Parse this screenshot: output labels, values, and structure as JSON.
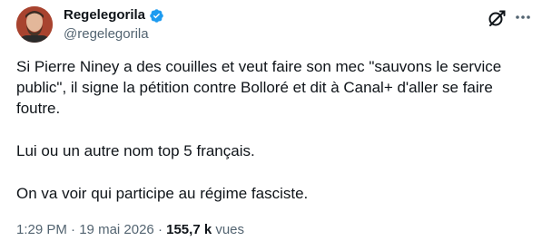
{
  "author": {
    "display_name": "Regelegorila",
    "handle": "@regelegorila",
    "verified": true
  },
  "tweet": {
    "paragraphs": [
      "Si Pierre Niney a des couilles et veut faire son mec \"sauvons le service public\", il signe la pétition contre Bolloré et dit à Canal+ d'aller se faire foutre.",
      "Lui ou un autre nom top 5 français.",
      "On va voir qui participe au régime fasciste."
    ]
  },
  "meta": {
    "time": "1:29 PM",
    "separator": "·",
    "date": "19 mai 2026",
    "views_count": "155,7 k",
    "views_label": "vues"
  },
  "icons": {
    "verified": "verified-badge-icon",
    "grok": "grok-icon",
    "more": "more-dots-icon"
  },
  "colors": {
    "verified_blue": "#1d9bf0",
    "text_primary": "#0f1419",
    "text_secondary": "#536471"
  }
}
